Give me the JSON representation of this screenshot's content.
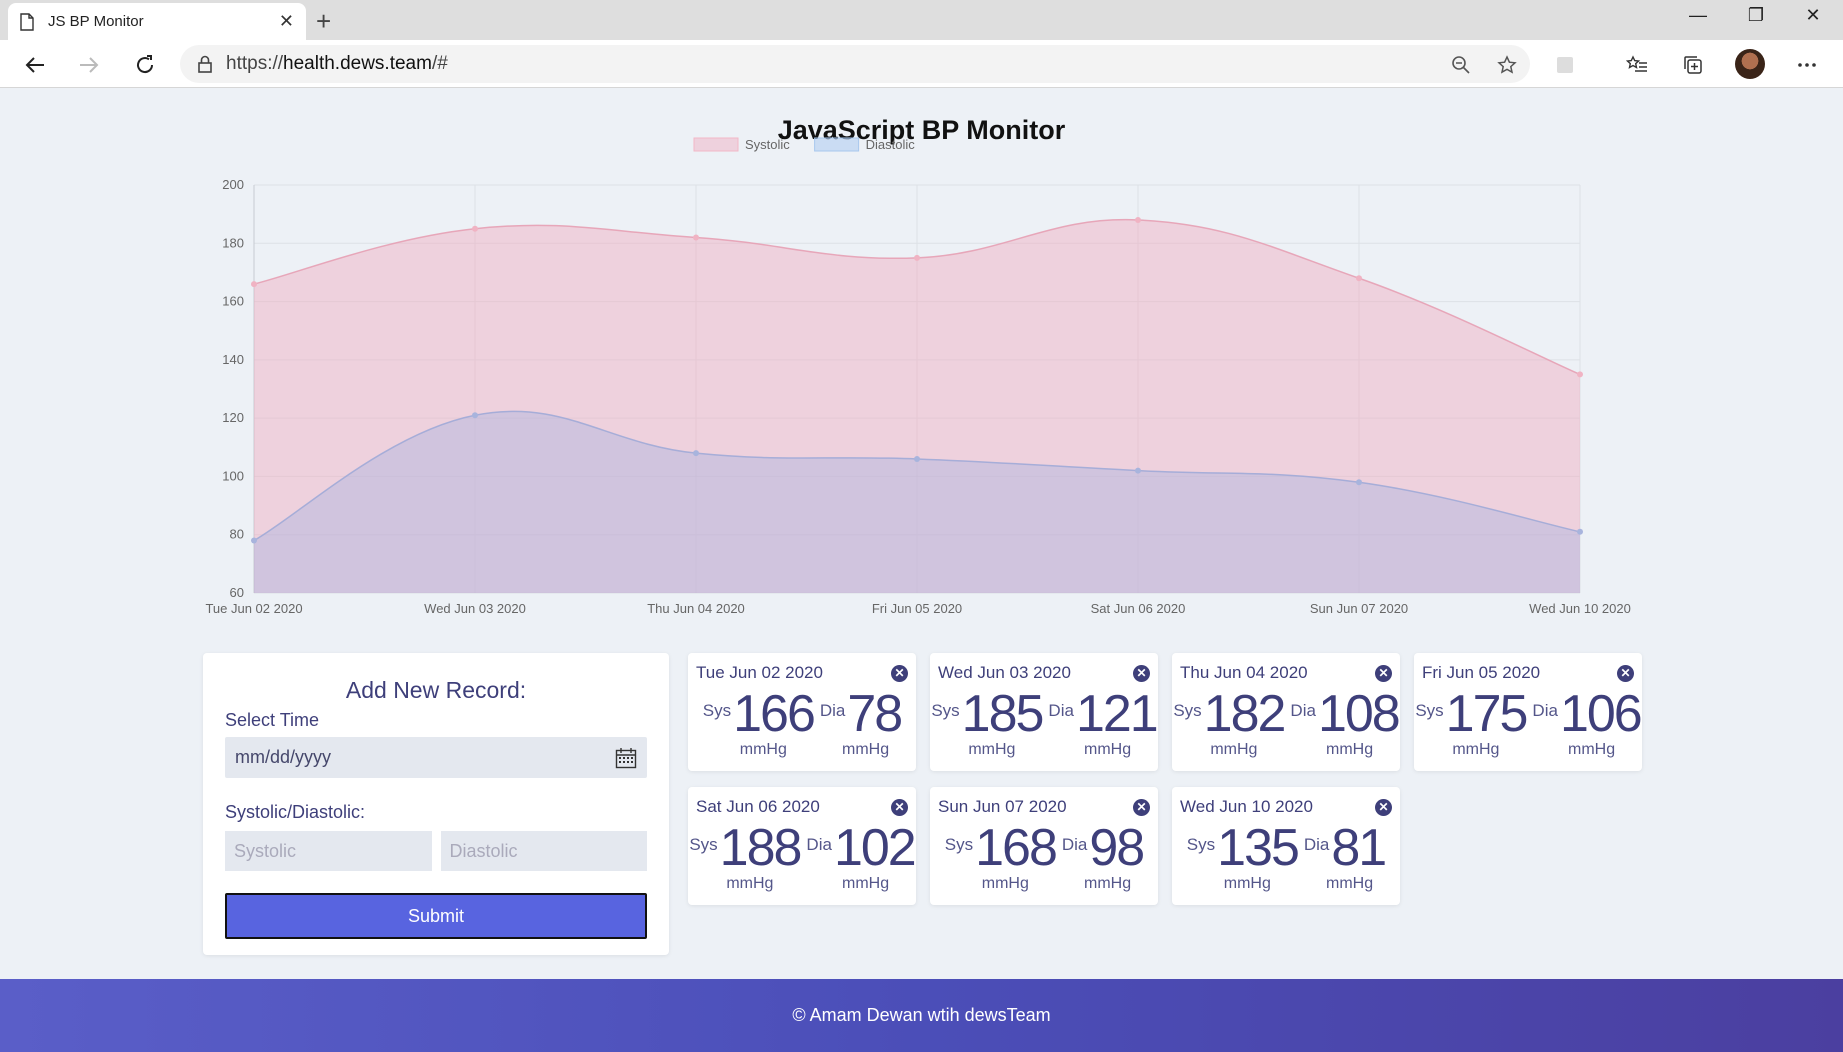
{
  "browser": {
    "tab_title": "JS BP Monitor",
    "url_prefix": "https://",
    "url_host": "health.dews.team",
    "url_suffix": "/#"
  },
  "page": {
    "title": "JavaScript BP Monitor"
  },
  "chart_data": {
    "type": "area",
    "title": "",
    "legend": [
      "Systolic",
      "Diastolic"
    ],
    "legend_position": "top",
    "x": [
      "Tue Jun 02 2020",
      "Wed Jun 03 2020",
      "Thu Jun 04 2020",
      "Fri Jun 05 2020",
      "Sat Jun 06 2020",
      "Sun Jun 07 2020",
      "Wed Jun 10 2020"
    ],
    "series": [
      {
        "name": "Systolic",
        "values": [
          166,
          185,
          182,
          175,
          188,
          168,
          135
        ],
        "color": "#f3c6d3"
      },
      {
        "name": "Diastolic",
        "values": [
          78,
          121,
          108,
          106,
          102,
          98,
          81
        ],
        "color": "#c9b9dd"
      }
    ],
    "ylim": [
      60,
      200
    ],
    "yticks": [
      60,
      80,
      100,
      120,
      140,
      160,
      180,
      200
    ],
    "grid": true,
    "curve": "smooth"
  },
  "form": {
    "title": "Add New Record:",
    "time_label": "Select Time",
    "date_placeholder": "mm/dd/yyyy",
    "bp_label": "Systolic/Diastolic:",
    "systolic_placeholder": "Systolic",
    "diastolic_placeholder": "Diastolic",
    "submit_label": "Submit"
  },
  "record_labels": {
    "sys": "Sys",
    "dia": "Dia",
    "unit": "mmHg"
  },
  "records": [
    {
      "date": "Tue Jun 02 2020",
      "sys": "166",
      "dia": "78"
    },
    {
      "date": "Wed Jun 03 2020",
      "sys": "185",
      "dia": "121"
    },
    {
      "date": "Thu Jun 04 2020",
      "sys": "182",
      "dia": "108"
    },
    {
      "date": "Fri Jun 05 2020",
      "sys": "175",
      "dia": "106"
    },
    {
      "date": "Sat Jun 06 2020",
      "sys": "188",
      "dia": "102"
    },
    {
      "date": "Sun Jun 07 2020",
      "sys": "168",
      "dia": "98"
    },
    {
      "date": "Wed Jun 10 2020",
      "sys": "135",
      "dia": "81"
    }
  ],
  "footer": {
    "text": "© Amam Dewan wtih dewsTeam"
  }
}
